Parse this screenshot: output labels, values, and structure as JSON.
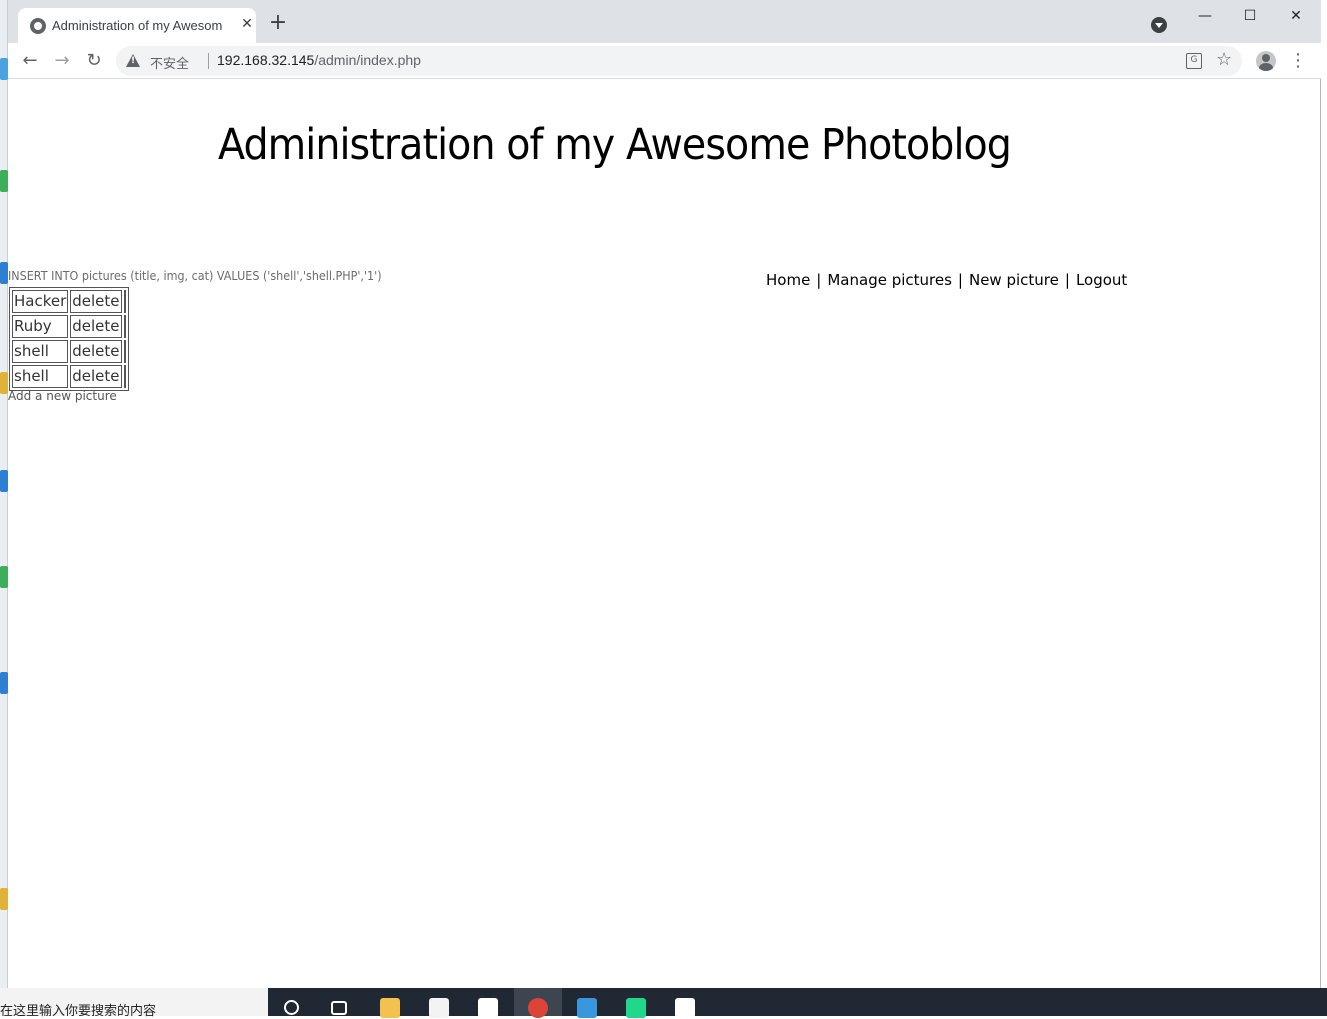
{
  "browser": {
    "tab_title": "Administration of my Awesom",
    "tab_close": "✕",
    "new_tab": "+",
    "win_minimize": "—",
    "win_maximize": "☐",
    "win_close": "✕",
    "nav_back": "←",
    "nav_forward": "→",
    "nav_reload": "↻",
    "insecure_label": "不安全",
    "url_host": "192.168.32.145",
    "url_path": "/admin/index.php",
    "translate_glyph": "G",
    "star_glyph": "☆",
    "menu_glyph": "⋮"
  },
  "page": {
    "title": "Administration of my Awesome Photoblog",
    "sql_debug": "INSERT INTO pictures (title, img, cat) VALUES ('shell','shell.PHP','1')",
    "nav": {
      "home": "Home",
      "manage": "Manage pictures",
      "new": "New picture",
      "logout": "Logout",
      "separator": "|"
    },
    "pictures": [
      {
        "title": "Hacker",
        "action": "delete"
      },
      {
        "title": "Ruby",
        "action": "delete"
      },
      {
        "title": "shell",
        "action": "delete"
      },
      {
        "title": "shell",
        "action": "delete"
      }
    ],
    "add_link": "Add a new picture"
  },
  "taskbar": {
    "search_placeholder": "在这里输入你要搜索的内容",
    "colors": {
      "explorer": "#f2c14e",
      "store": "#f3f3f3",
      "mail": "#ffffff",
      "chrome": "#db4437",
      "vmware": "#3a96dd",
      "pycharm": "#21d789",
      "burp": "#ffffff"
    }
  }
}
